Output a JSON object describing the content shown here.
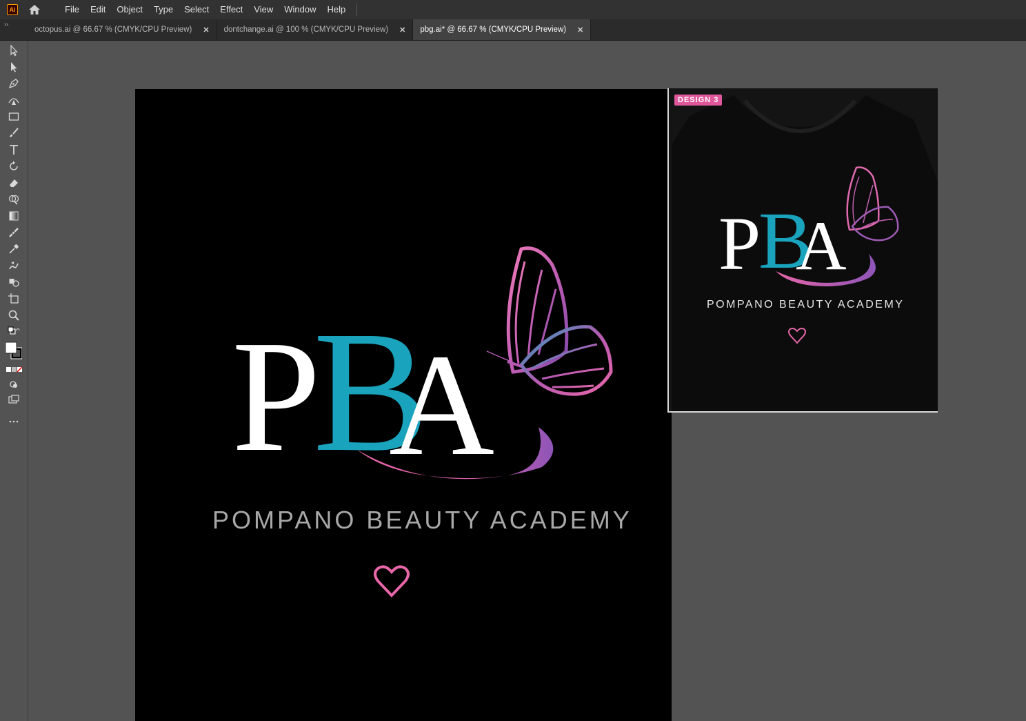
{
  "app": {
    "logo": "Ai",
    "menu": [
      "File",
      "Edit",
      "Object",
      "Type",
      "Select",
      "Effect",
      "View",
      "Window",
      "Help"
    ]
  },
  "tabs": [
    {
      "label": "octopus.ai @ 66.67 % (CMYK/CPU Preview)",
      "active": false
    },
    {
      "label": "dontchange.ai @ 100 % (CMYK/CPU Preview)",
      "active": false
    },
    {
      "label": "pbg.ai* @ 66.67 % (CMYK/CPU Preview)",
      "active": true
    }
  ],
  "tools": [
    "selection-icon",
    "direct-selection-icon",
    "pen-icon",
    "curvature-icon",
    "rectangle-icon",
    "paintbrush-icon",
    "type-icon",
    "rotate-icon",
    "eraser-icon",
    "shape-builder-icon",
    "gradient-icon",
    "measure-icon",
    "eyedropper-icon",
    "blend-icon",
    "live-paint-icon",
    "artboard-icon",
    "zoom-icon",
    "default-colors-icon",
    "swap-colors-icon",
    "fill-stroke-icon",
    "color-mode-icon",
    "draw-mode-icon",
    "screen-mode-icon",
    "more-tools-icon"
  ],
  "artwork": {
    "letters": {
      "p": "P",
      "b": "B",
      "a": "A"
    },
    "tagline": "POMPANO BEAUTY ACADEMY",
    "colors": {
      "white": "#ffffff",
      "teal": "#1aa3bd",
      "pink": "#e767a8",
      "purple": "#8e55b8",
      "gray": "#a8a8a8"
    }
  },
  "reference": {
    "badge": "DESIGN 3",
    "letters": {
      "p": "P",
      "b": "B",
      "a": "A"
    },
    "tagline": "POMPANO BEAUTY ACADEMY"
  }
}
